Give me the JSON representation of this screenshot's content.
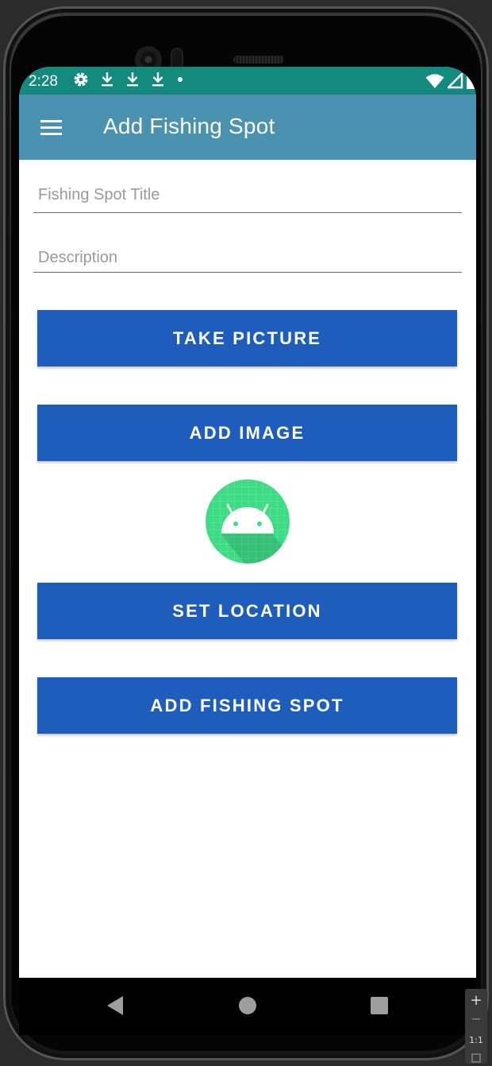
{
  "status_bar": {
    "time": "2:28",
    "icons_left": [
      "gear-icon",
      "download-icon",
      "download-icon",
      "download-icon",
      "dot-icon"
    ],
    "icons_right": [
      "wifi-icon",
      "signal-icon",
      "battery-icon"
    ],
    "color": "#148a7f"
  },
  "app_bar": {
    "title": "Add Fishing Spot",
    "menu_icon": "hamburger-menu-icon",
    "color": "#4b91b0"
  },
  "form": {
    "title_field": {
      "value": "",
      "placeholder": "Fishing Spot Title"
    },
    "description_field": {
      "value": "",
      "placeholder": "Description"
    }
  },
  "buttons": {
    "take_picture": "TAKE PICTURE",
    "add_image": "ADD IMAGE",
    "set_location": "SET LOCATION",
    "add_fishing_spot": "ADD FISHING SPOT",
    "color": "#1f5dbd"
  },
  "image_preview": {
    "icon": "android-robot-icon",
    "color": "#3ddc84"
  },
  "nav_bar": {
    "buttons": [
      "back-icon",
      "home-icon",
      "recents-icon"
    ]
  },
  "emulator_zoom": {
    "zoom_in": "+",
    "zoom_out": "−",
    "actual_size": "1:1"
  }
}
